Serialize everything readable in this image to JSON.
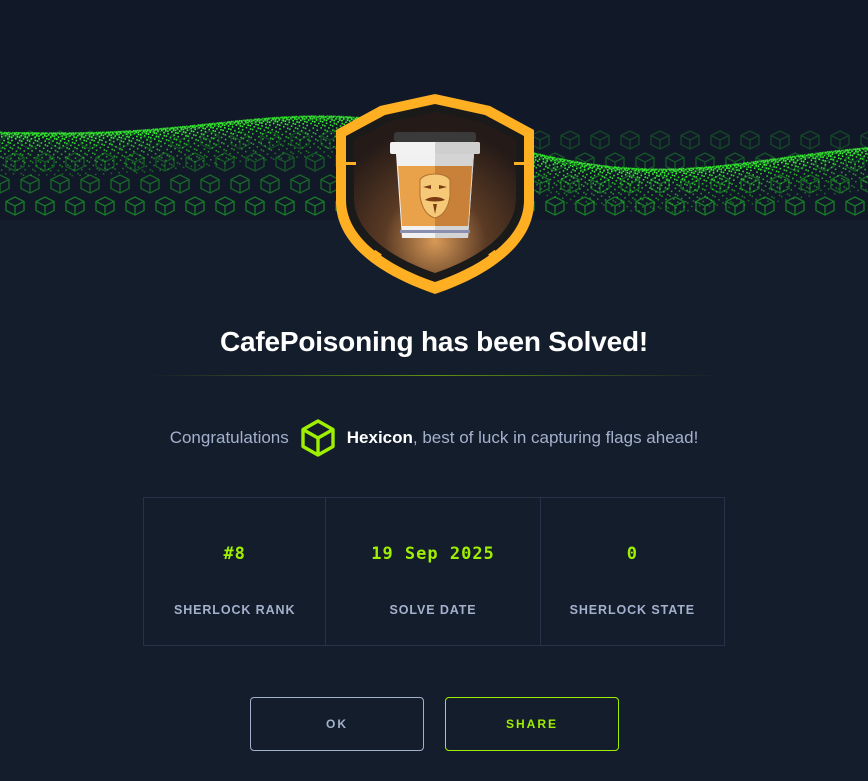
{
  "title": "CafePoisoning has been Solved!",
  "congrats": {
    "prefix": "Congratulations",
    "username": "Hexicon",
    "suffix": ", best of luck in capturing flags ahead!"
  },
  "stats": [
    {
      "value": "#8",
      "label": "SHERLOCK RANK"
    },
    {
      "value": "19 Sep 2025",
      "label": "SOLVE DATE"
    },
    {
      "value": "0",
      "label": "SHERLOCK STATE"
    }
  ],
  "buttons": {
    "ok_label": "OK",
    "share_label": "SHARE"
  },
  "colors": {
    "background": "#141d2b",
    "accent": "#9fef00",
    "badge_orange": "#ffaf00",
    "text_muted": "#a4b1cd"
  },
  "icons": {
    "badge": "coffee-cup-badge-icon",
    "avatar": "hexagon-cube-avatar-icon"
  }
}
